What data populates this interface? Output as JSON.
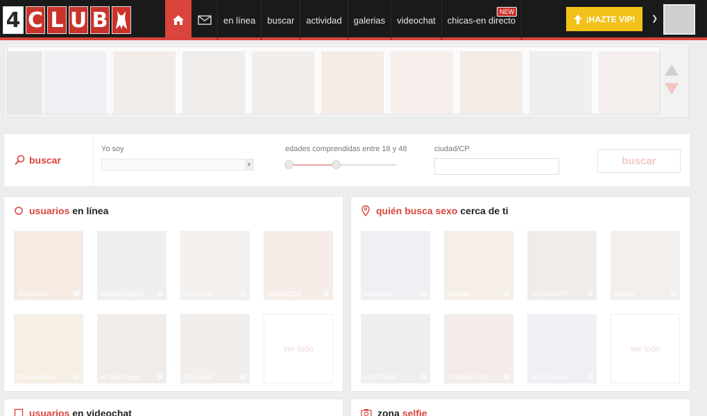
{
  "header": {
    "logo": [
      "4",
      "C",
      "L",
      "U",
      "B"
    ],
    "nav": {
      "online": "en línea",
      "search": "buscar",
      "activity": "actividad",
      "galleries": "galerias",
      "videochat": "videochat",
      "live_girls": "chicas-en directo",
      "new_badge": "NEW"
    },
    "vip_label": "¡HAZTE VIP!"
  },
  "search": {
    "title": "buscar",
    "i_am_label": "Yo soy",
    "ages_label": "edades comprendidas entre 18 y 48",
    "age_min": 18,
    "age_max": 48,
    "city_label": "ciudad/CP",
    "city_value": "",
    "button": "buscar"
  },
  "online_panel": {
    "title_hl": "usuarios",
    "title_rest": " en línea",
    "users": [
      "X0y13nS4k",
      "uUM0eG6g4A7",
      "rneI3C3bz",
      "LwpD8C2p6",
      "FPmemm8Hv",
      "nF38vc3SgHIr",
      "TMcjYeHD"
    ],
    "see_all": "ver todo"
  },
  "nearby_panel": {
    "title_hl": "quién busca sexo",
    "title_rest": " cerca de ti",
    "users": [
      "xxxcabica",
      "sssakaa",
      "LR3y08Dkj7P",
      "pdfttjek",
      "xX2ZP9t4kll",
      "SFRbt3rP64l5",
      "Jd1LVGeHuy"
    ],
    "see_all": "ver todo"
  },
  "videochat_panel": {
    "title_hl": "usuarios",
    "title_rest": " en videochat"
  },
  "selfie_panel": {
    "title_rest": "zona ",
    "title_hl": "selfie"
  },
  "colors": {
    "accent": "#d9443b",
    "vip": "#f2c21b",
    "topbar": "#1a1a1a"
  }
}
